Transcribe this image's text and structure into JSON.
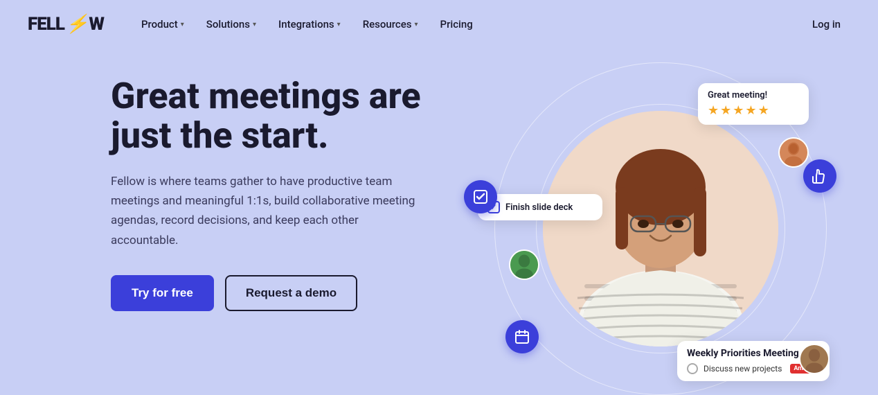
{
  "logo": {
    "text_before": "FELL",
    "slash": "⚡",
    "text_after": "W"
  },
  "nav": {
    "items": [
      {
        "label": "Product",
        "has_dropdown": true
      },
      {
        "label": "Solutions",
        "has_dropdown": true
      },
      {
        "label": "Integrations",
        "has_dropdown": true
      },
      {
        "label": "Resources",
        "has_dropdown": true
      },
      {
        "label": "Pricing",
        "has_dropdown": false
      }
    ],
    "login_label": "Log in"
  },
  "hero": {
    "title": "Great meetings are just the start.",
    "description": "Fellow is where teams gather to have productive team meetings and meaningful 1:1s, build collaborative meeting agendas, record decisions, and keep each other accountable.",
    "btn_primary": "Try for free",
    "btn_secondary": "Request a demo"
  },
  "floating": {
    "great_meeting": {
      "title": "Great meeting!",
      "stars": 5
    },
    "task": {
      "label": "Finish slide deck",
      "checked": true
    },
    "weekly_meeting": {
      "title": "Weekly Priorities Meeting",
      "item_text": "Discuss new projects",
      "badge": "Amir"
    }
  },
  "colors": {
    "bg": "#c8cff5",
    "accent": "#3b3fda",
    "text_dark": "#1a1a2e"
  }
}
